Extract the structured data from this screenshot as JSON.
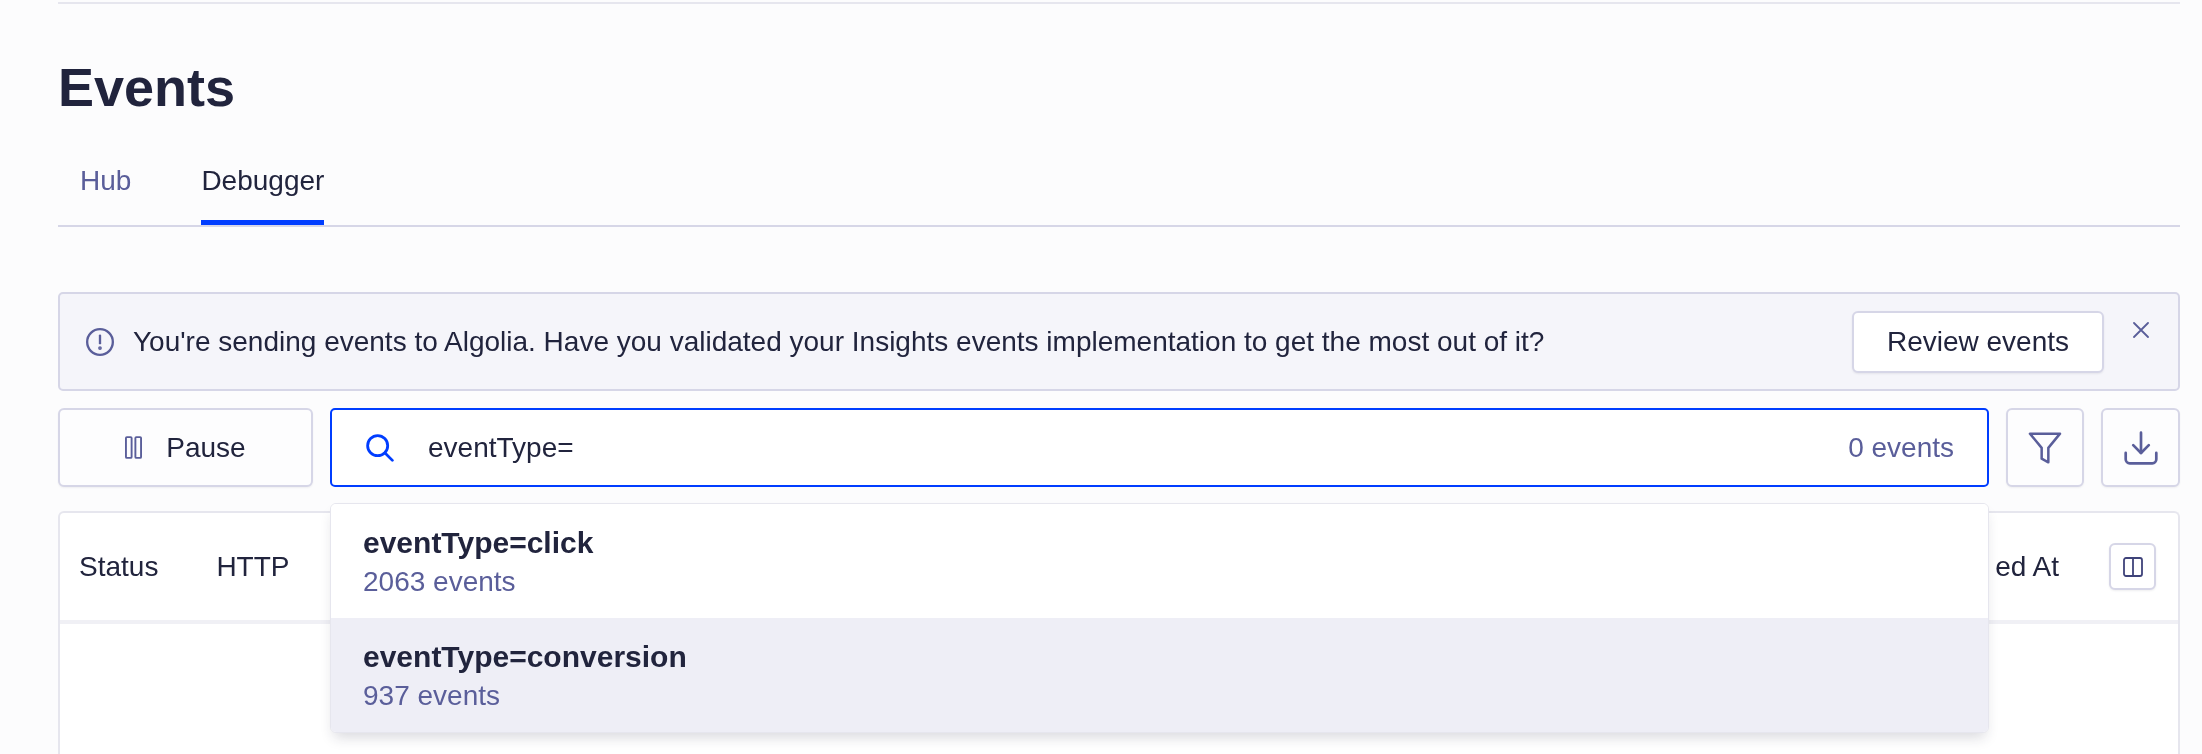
{
  "page": {
    "title": "Events"
  },
  "tabs": [
    {
      "label": "Hub",
      "selected": false
    },
    {
      "label": "Debugger",
      "selected": true
    }
  ],
  "banner": {
    "message": "You're sending events to Algolia. Have you validated your Insights events implementation to get the most out of it?",
    "action": "Review events"
  },
  "toolbar": {
    "pause": "Pause",
    "search": {
      "value": "eventType=",
      "focused": true,
      "count": "0 events",
      "suggestions": [
        {
          "query": "eventType=click",
          "count": "2063 events",
          "selected": false
        },
        {
          "query": "eventType=conversion",
          "count": "937 events",
          "selected": true
        }
      ]
    }
  },
  "table": {
    "columns": [
      "Status",
      "HTTP",
      "ed At"
    ]
  }
}
